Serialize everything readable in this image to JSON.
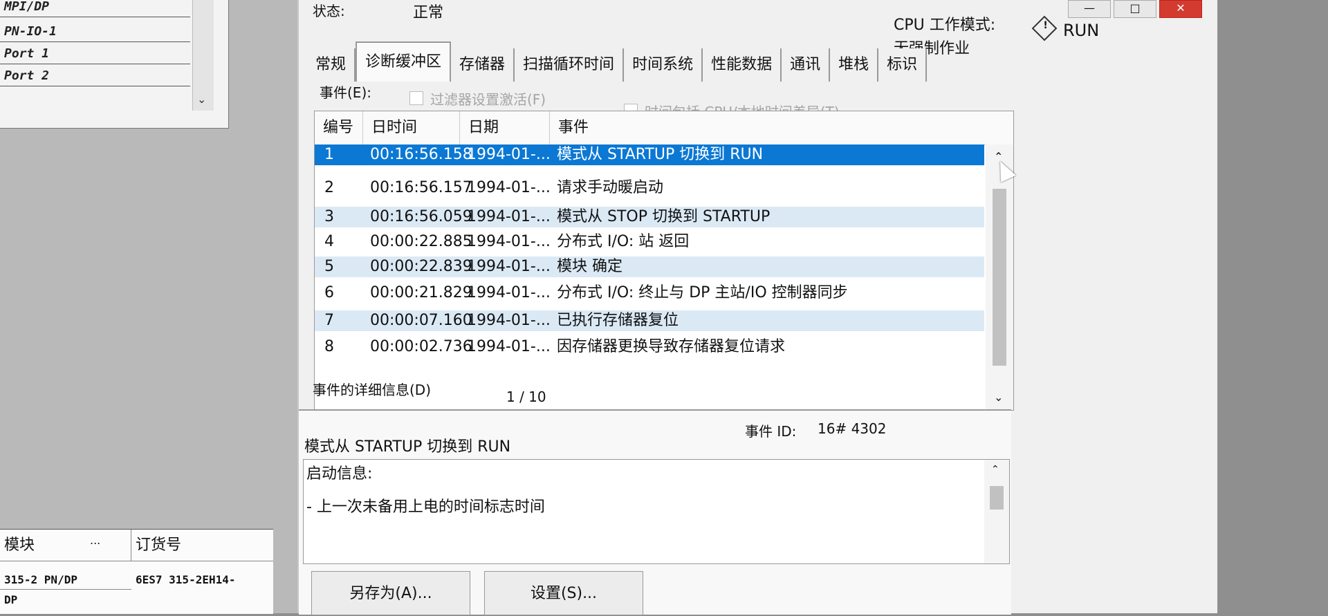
{
  "left_tree": {
    "items": [
      "MPI/DP",
      "PN-IO-1",
      "Port 1",
      "Port 2"
    ]
  },
  "module_table": {
    "headers": [
      "模块",
      "订货号"
    ],
    "ellipsis": "...",
    "rows": [
      {
        "module": "315-2 PN/DP",
        "order_no": "6ES7 315-2EH14-"
      },
      {
        "module": "DP",
        "order_no": ""
      }
    ]
  },
  "dialog": {
    "status_label": "状态:",
    "status_value": "正常",
    "cpu_mode_label": "CPU 工作模式:",
    "cpu_mode_value": "RUN",
    "operation_mode": "无强制作业",
    "tabs": [
      "常规",
      "诊断缓冲区",
      "存储器",
      "扫描循环时间",
      "时间系统",
      "性能数据",
      "通讯",
      "堆栈",
      "标识"
    ],
    "active_tab": "诊断缓冲区",
    "events_label": "事件(E):",
    "filter_label": "过滤器设置激活(F)",
    "time_diff_label": "时间包括 CPU/本地时间差异(T)",
    "event_columns": [
      "编号",
      "日时间",
      "日期",
      "事件"
    ],
    "events": [
      {
        "no": "1",
        "time": "00:16:56.158",
        "date": "1994-01-...",
        "event": "模式从 STARTUP 切换到 RUN"
      },
      {
        "no": "2",
        "time": "00:16:56.157",
        "date": "1994-01-...",
        "event": "请求手动暖启动"
      },
      {
        "no": "3",
        "time": "00:16:56.059",
        "date": "1994-01-...",
        "event": "模式从 STOP 切换到 STARTUP"
      },
      {
        "no": "4",
        "time": "00:00:22.885",
        "date": "1994-01-...",
        "event": "分布式 I/O: 站 返回"
      },
      {
        "no": "5",
        "time": "00:00:22.839",
        "date": "1994-01-...",
        "event": "模块 确定"
      },
      {
        "no": "6",
        "time": "00:00:21.829",
        "date": "1994-01-...",
        "event": "分布式 I/O: 终止与 DP 主站/IO 控制器同步"
      },
      {
        "no": "7",
        "time": "00:00:07.160",
        "date": "1994-01-...",
        "event": "已执行存储器复位"
      },
      {
        "no": "8",
        "time": "00:00:02.736",
        "date": "1994-01-...",
        "event": "因存储器更换导致存储器复位请求"
      }
    ],
    "details_label": "事件的详细信息(D)",
    "page_indicator": "1 / 10",
    "event_id_label": "事件 ID:",
    "event_id_value": "16# 4302",
    "detail_title": "模式从 STARTUP 切换到 RUN",
    "startup_info_label": "启动信息:",
    "startup_info_line": "- 上一次未备用上电的时间标志时间",
    "save_as_button": "另存为(A)...",
    "settings_button": "设置(S)..."
  }
}
